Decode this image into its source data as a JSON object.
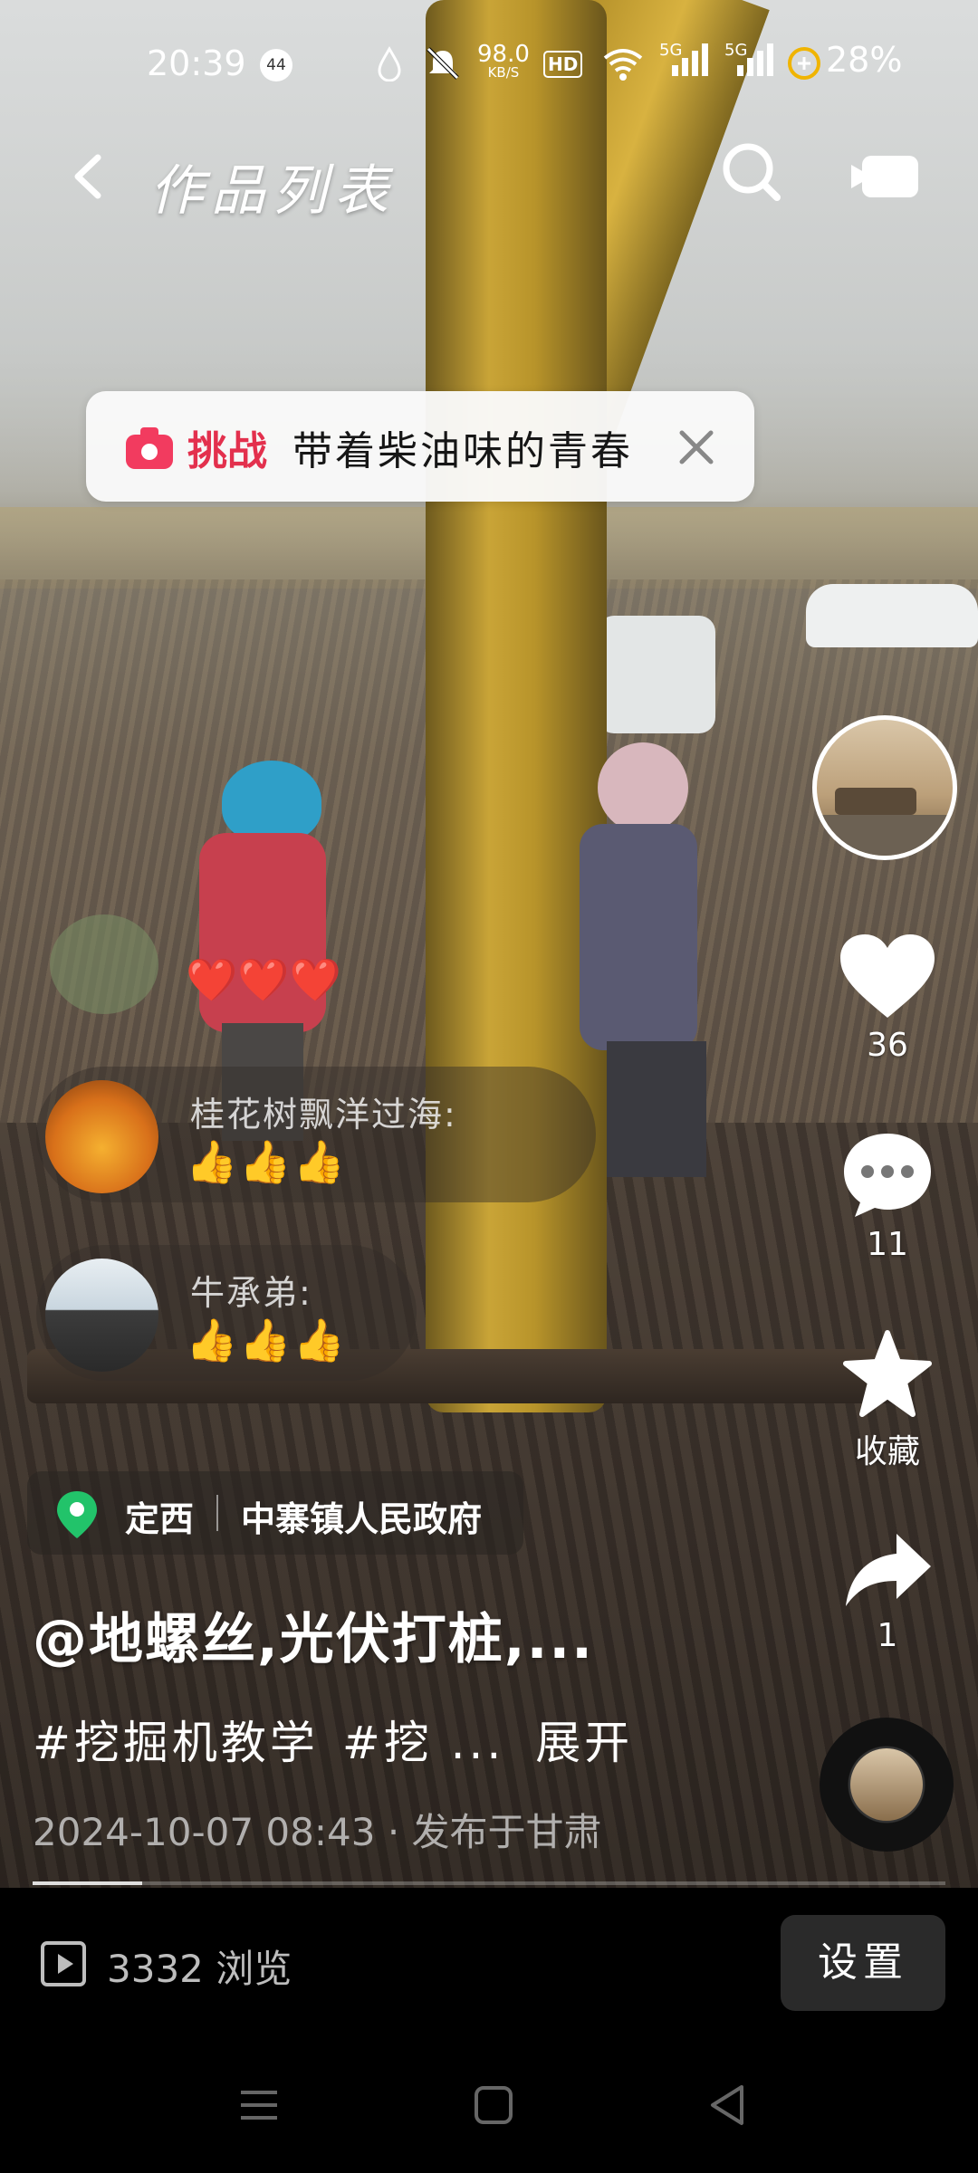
{
  "status_bar": {
    "time": "20:39",
    "notification_count": "44",
    "net_speed_value": "98.0",
    "net_speed_unit": "KB/S",
    "hd_label": "HD",
    "sim1_label": "5G",
    "sim2_label": "5G",
    "battery": "28%"
  },
  "header": {
    "title": "作品列表"
  },
  "challenge": {
    "tag": "挑战",
    "text": "带着柴油味的青春"
  },
  "actions": {
    "likes": "36",
    "comments": "11",
    "favorite_label": "收藏",
    "shares": "1"
  },
  "comments": {
    "partial_text": "❤️❤️❤️",
    "items": [
      {
        "name": "桂花树飘洋过海:",
        "text": "👍👍👍"
      },
      {
        "name": "牛承弟:",
        "text": "👍👍👍"
      }
    ]
  },
  "location": {
    "city": "定西",
    "place": "中寨镇人民政府"
  },
  "post": {
    "caption": "@地螺丝,光伏打桩,...",
    "tag1": "#挖掘机教学",
    "tag2": "#挖 ...",
    "expand_label": "展开",
    "meta": "2024-10-07 08:43 · 发布于甘肃",
    "progress": 0.12
  },
  "bottom": {
    "views_count": "3332",
    "views_label": "浏览",
    "settings_label": "设置"
  },
  "icons": {
    "back": "chevron-left-icon",
    "search": "search-icon",
    "camera": "video-camera-icon",
    "like": "heart-icon",
    "comment": "comment-bubble-icon",
    "favorite": "star-icon",
    "share": "share-arrow-icon",
    "location": "location-pin-icon",
    "views": "play-square-icon"
  },
  "colors": {
    "challenge_accent": "#e3304d",
    "comment_text": "#f4b52a",
    "location_pin": "#22c36a"
  }
}
